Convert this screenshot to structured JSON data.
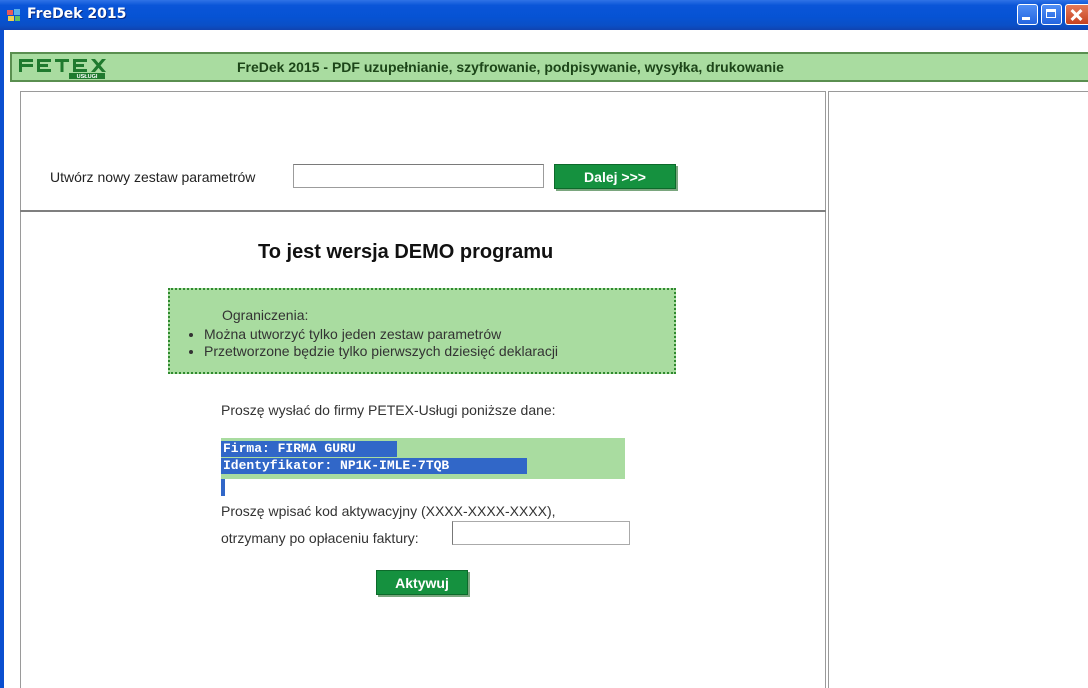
{
  "window": {
    "title": "FreDek 2015"
  },
  "header": {
    "logo_text": "PETEX USŁUGI",
    "title": "FreDek 2015 - PDF uzupełnianie, szyfrowanie, podpisywanie, wysyłka, drukowanie"
  },
  "create_set": {
    "label": "Utwórz nowy zestaw parametrów",
    "input_value": "",
    "next_button": "Dalej >>>"
  },
  "demo": {
    "title": "To jest wersja DEMO programu",
    "limits_heading": "Ograniczenia:",
    "limits": [
      "Można utworzyć tylko jeden zestaw parametrów",
      "Przetworzone będzie tylko pierwszych dziesięć deklaracji"
    ]
  },
  "registration": {
    "send_label": "Proszę wysłać do firmy PETEX-Usługi poniższe dane:",
    "company_line": "Firma: FIRMA GURU",
    "identifier_line": "Identyfikator: NP1K-IMLE-7TQB",
    "activation_label_line1": "Proszę wpisać kod aktywacyjny (XXXX-XXXX-XXXX),",
    "activation_label_line2": "otrzymany po opłaceniu faktury:",
    "activation_code_value": "",
    "activate_button": "Aktywuj"
  },
  "colors": {
    "accent_green": "#15913f",
    "panel_green": "#a9dca0",
    "selection_blue": "#3167c8",
    "titlebar_blue": "#0653d4"
  },
  "icons": {
    "app": "fredek-app-icon",
    "minimize": "minimize-icon",
    "maximize": "maximize-icon",
    "close": "close-icon"
  }
}
